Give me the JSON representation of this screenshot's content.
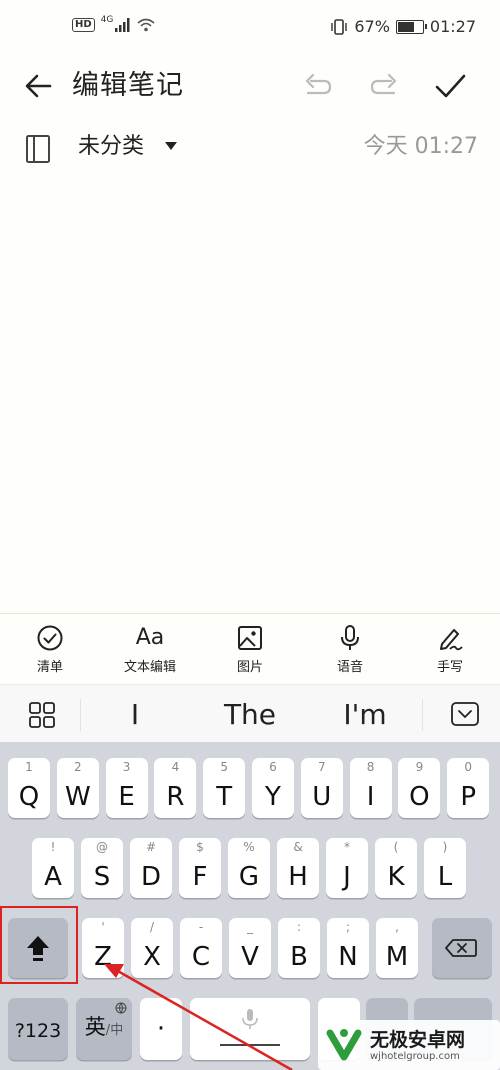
{
  "status_bar": {
    "hd": "HD",
    "network": "4G",
    "battery_percent": "67%",
    "time": "01:27"
  },
  "header": {
    "title": "编辑笔记"
  },
  "meta": {
    "category": "未分类",
    "date": "今天 01:27"
  },
  "toolbar": {
    "items": [
      {
        "label": "清单",
        "icon": "checklist-icon"
      },
      {
        "label": "文本编辑",
        "icon": "text-format-icon",
        "glyph": "Aa"
      },
      {
        "label": "图片",
        "icon": "image-icon"
      },
      {
        "label": "语音",
        "icon": "microphone-icon"
      },
      {
        "label": "手写",
        "icon": "handwriting-icon"
      }
    ]
  },
  "suggestions": [
    "I",
    "The",
    "I'm"
  ],
  "keyboard": {
    "row1": [
      {
        "k": "Q",
        "h": "1"
      },
      {
        "k": "W",
        "h": "2"
      },
      {
        "k": "E",
        "h": "3"
      },
      {
        "k": "R",
        "h": "4"
      },
      {
        "k": "T",
        "h": "5"
      },
      {
        "k": "Y",
        "h": "6"
      },
      {
        "k": "U",
        "h": "7"
      },
      {
        "k": "I",
        "h": "8"
      },
      {
        "k": "O",
        "h": "9"
      },
      {
        "k": "P",
        "h": "0"
      }
    ],
    "row2": [
      {
        "k": "A",
        "h": "!"
      },
      {
        "k": "S",
        "h": "@"
      },
      {
        "k": "D",
        "h": "#"
      },
      {
        "k": "F",
        "h": "$"
      },
      {
        "k": "G",
        "h": "%"
      },
      {
        "k": "H",
        "h": "&"
      },
      {
        "k": "J",
        "h": "*"
      },
      {
        "k": "K",
        "h": "("
      },
      {
        "k": "L",
        "h": ")"
      }
    ],
    "row3": [
      {
        "k": "Z",
        "h": "'"
      },
      {
        "k": "X",
        "h": "/"
      },
      {
        "k": "C",
        "h": "-"
      },
      {
        "k": "V",
        "h": "_"
      },
      {
        "k": "B",
        "h": ":"
      },
      {
        "k": "N",
        "h": ";"
      },
      {
        "k": "M",
        "h": ","
      }
    ],
    "num_label": "?123",
    "lang_label": "英",
    "lang_sub": "中",
    "dot_label": "·"
  },
  "watermark": {
    "name": "无极安卓网",
    "url": "wjhotelgroup.com"
  },
  "colors": {
    "accent_annotation": "#dd2222",
    "keyboard_bg": "#d2d5db"
  }
}
